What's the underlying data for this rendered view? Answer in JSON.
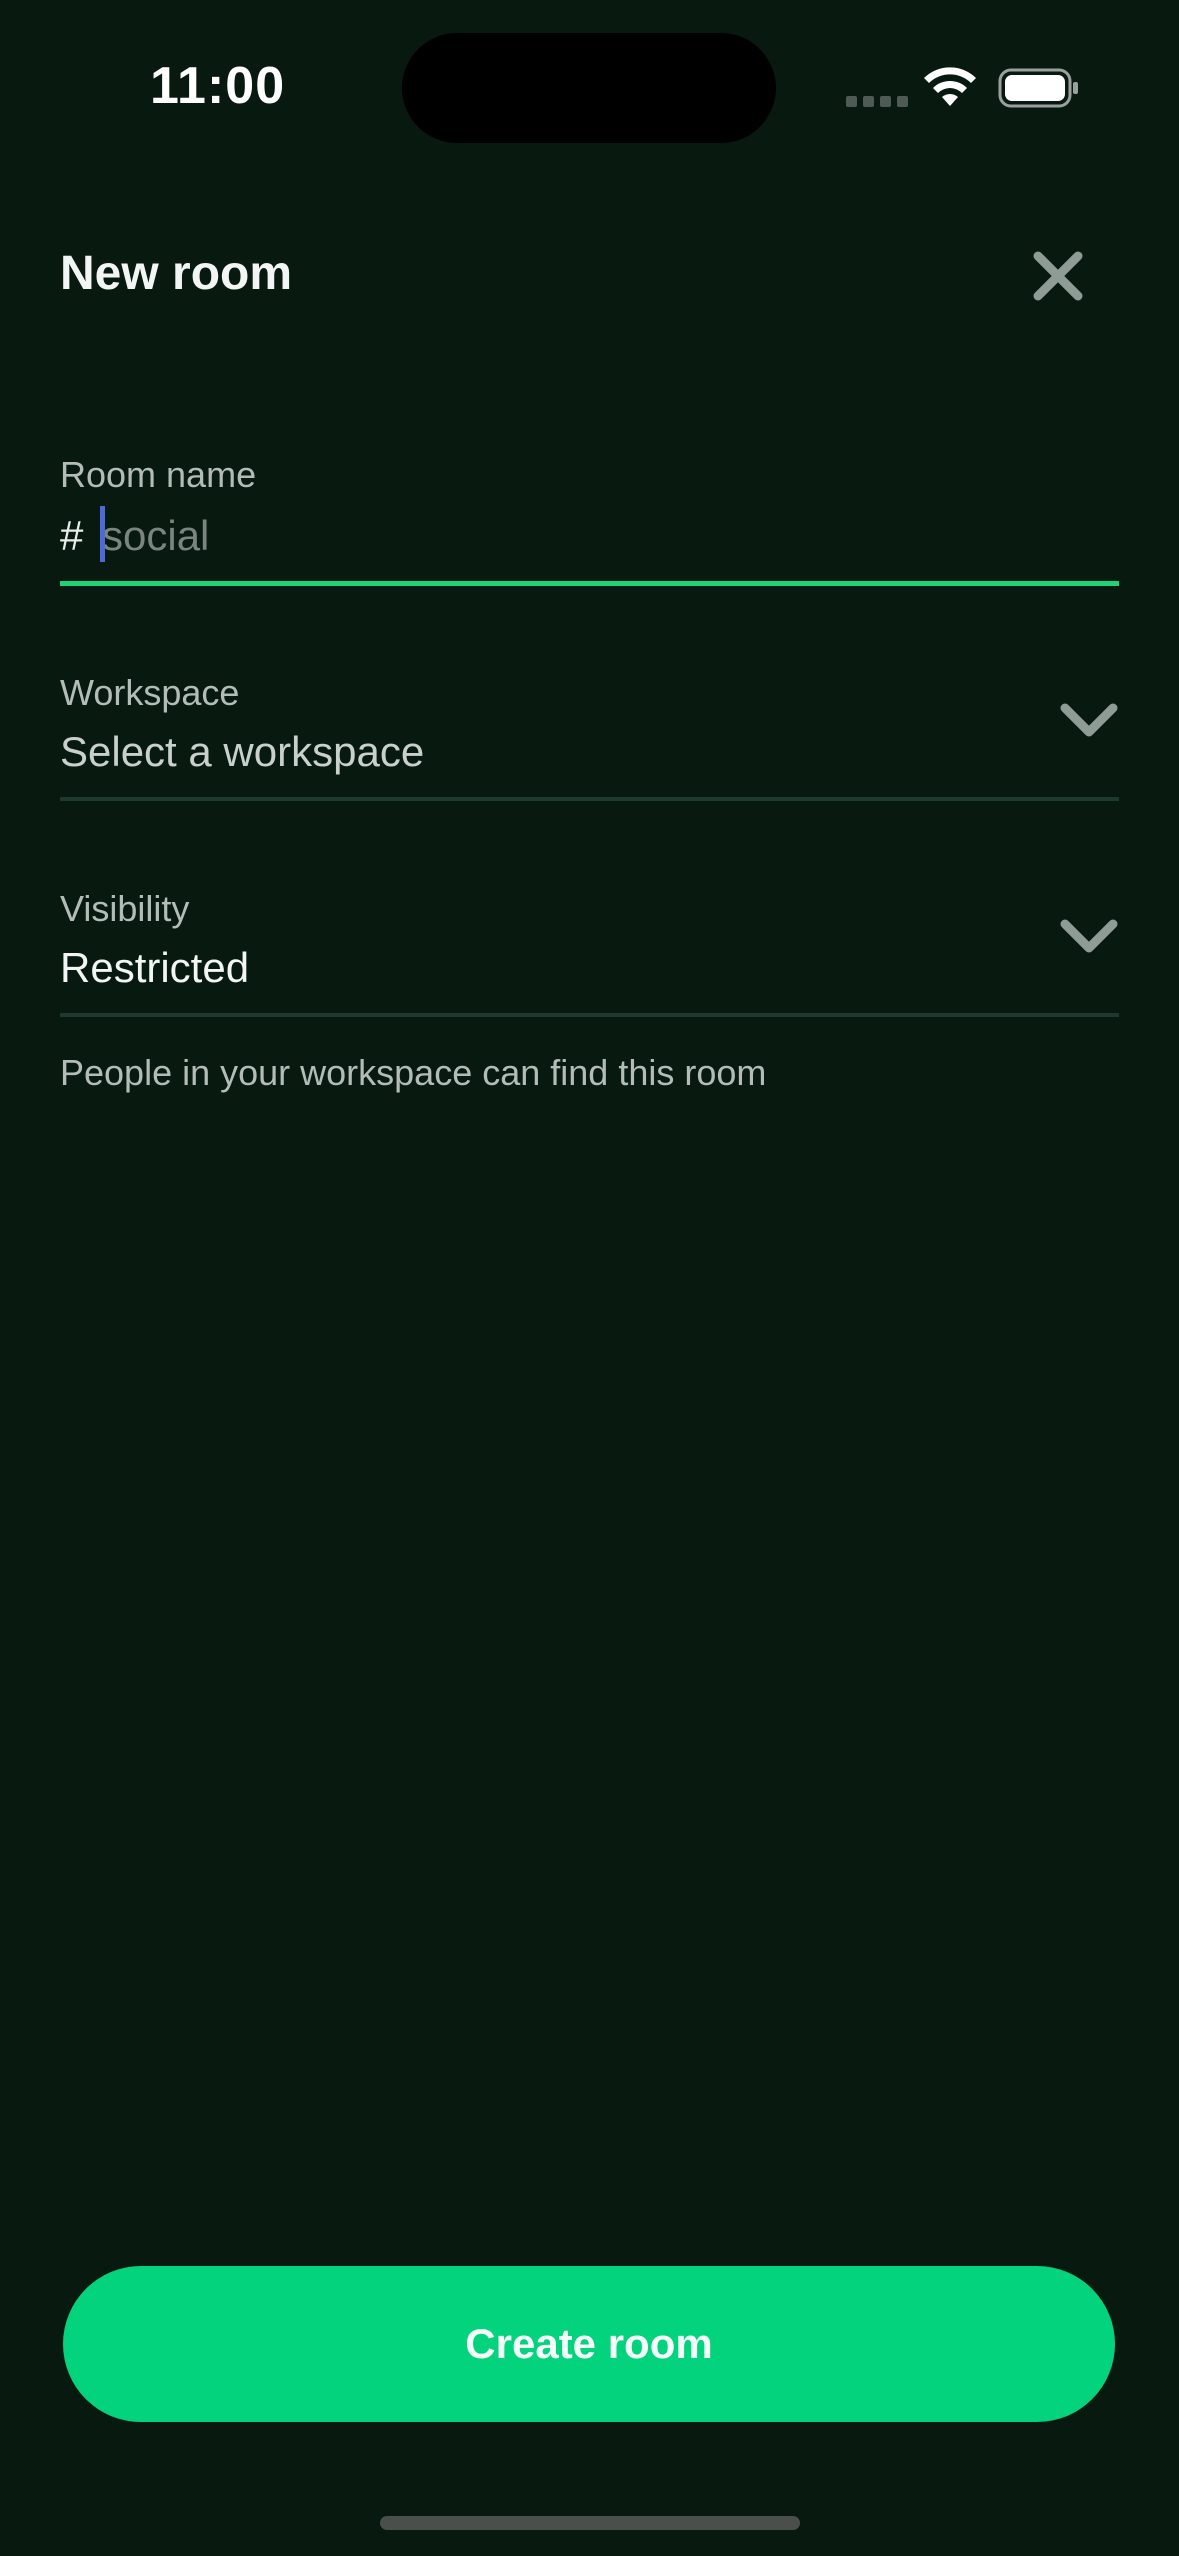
{
  "status_bar": {
    "time": "11:00",
    "icons": [
      "signal-dots-icon",
      "wifi-icon",
      "battery-icon"
    ]
  },
  "header": {
    "title": "New room",
    "close_icon": "close-icon"
  },
  "room_name": {
    "label": "Room name",
    "prefix": "#",
    "value": "",
    "placeholder": "social"
  },
  "workspace": {
    "label": "Workspace",
    "value": "Select a workspace",
    "icon": "chevron-down-icon"
  },
  "visibility": {
    "label": "Visibility",
    "value": "Restricted",
    "icon": "chevron-down-icon",
    "helper_text": "People in your workspace can find this room"
  },
  "actions": {
    "create_label": "Create room"
  },
  "colors": {
    "background": "#081a10",
    "accent": "#02d37c",
    "active_underline": "#1fd27a",
    "caret": "#4d6ad8"
  }
}
